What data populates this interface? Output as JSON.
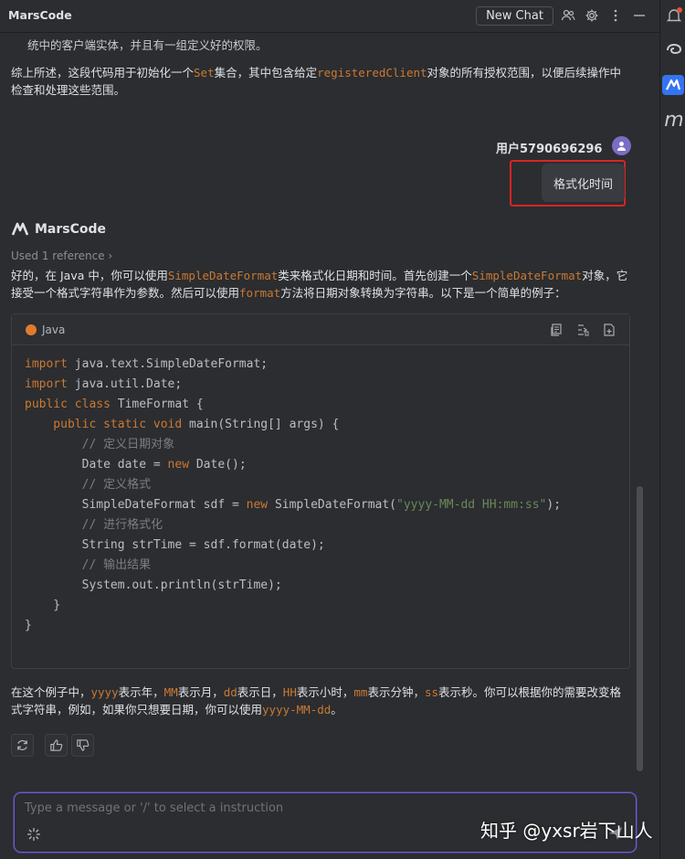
{
  "header": {
    "app_title": "MarsCode",
    "new_chat_label": "New Chat",
    "icons": [
      "users-icon",
      "gear-icon",
      "more-vertical-icon",
      "minimize-icon"
    ]
  },
  "rail": {
    "icons": [
      "bell-icon",
      "swirl-icon",
      "marscode-icon",
      "m-icon"
    ],
    "m_glyph": "m"
  },
  "previous": {
    "line1": "统中的客户端实体，并且有一组定义好的权限。",
    "summary_a": "综上所述，这段代码用于初始化一个",
    "summary_code1": "Set",
    "summary_b": "集合，其中包含给定",
    "summary_code2": "registeredClient",
    "summary_c": "对象的所有授权范围，以便后续操作中检查和处理这些范围。"
  },
  "user_message": {
    "name": "用户5790696296",
    "text": "格式化时间"
  },
  "bot_message": {
    "name": "MarsCode",
    "reference": "Used 1 reference ›",
    "intro_a": "好的，在 Java 中，你可以使用",
    "intro_code1": "SimpleDateFormat",
    "intro_b": "类来格式化日期和时间。首先创建一个",
    "intro_code2": "SimpleDateFormat",
    "intro_c": "对象，它接受一个格式字符串作为参数。然后可以使用",
    "intro_code3": "format",
    "intro_d": "方法将日期对象转换为字符串。以下是一个简单的例子：",
    "code_lang": "Java",
    "code": {
      "l1_kw": "import",
      "l1": " java.text.SimpleDateFormat;",
      "l2_kw": "import",
      "l2": " java.util.Date;",
      "l3_kw": "public class",
      "l3": " TimeFormat {",
      "l4_kw": "    public static void",
      "l4": " main(String[] args) {",
      "l5": "        // 定义日期对象",
      "l6_a": "        Date date = ",
      "l6_kw": "new",
      "l6_b": " Date();",
      "l7": "        // 定义格式",
      "l8_a": "        SimpleDateFormat sdf = ",
      "l8_kw": "new",
      "l8_b": " SimpleDateFormat(",
      "l8_str": "\"yyyy-MM-dd HH:mm:ss\"",
      "l8_c": ");",
      "l9": "        // 进行格式化",
      "l10": "        String strTime = sdf.format(date);",
      "l11": "        // 输出结果",
      "l12": "        System.out.println(strTime);",
      "l13": "    }",
      "l14": "}"
    },
    "outro": {
      "a": "在这个例子中，",
      "c1": "yyyy",
      "b": "表示年，",
      "c2": "MM",
      "c": "表示月，",
      "c3": "dd",
      "d": "表示日，",
      "c4": "HH",
      "e": "表示小时，",
      "c5": "mm",
      "f": "表示分钟，",
      "c6": "ss",
      "g": "表示秒。你可以根据你的需要改变格式字符串，例如，如果你只想要日期，你可以使用",
      "c7": "yyyy-MM-dd",
      "h": "。"
    }
  },
  "input": {
    "placeholder": "Type a message or '/' to select a instruction"
  },
  "watermark": "知乎 @yxsr岩下山人",
  "colors": {
    "accent_code": "#cc7832",
    "highlight_box": "#d92424",
    "input_border": "#6f5be0",
    "avatar": "#7b6cc6"
  }
}
